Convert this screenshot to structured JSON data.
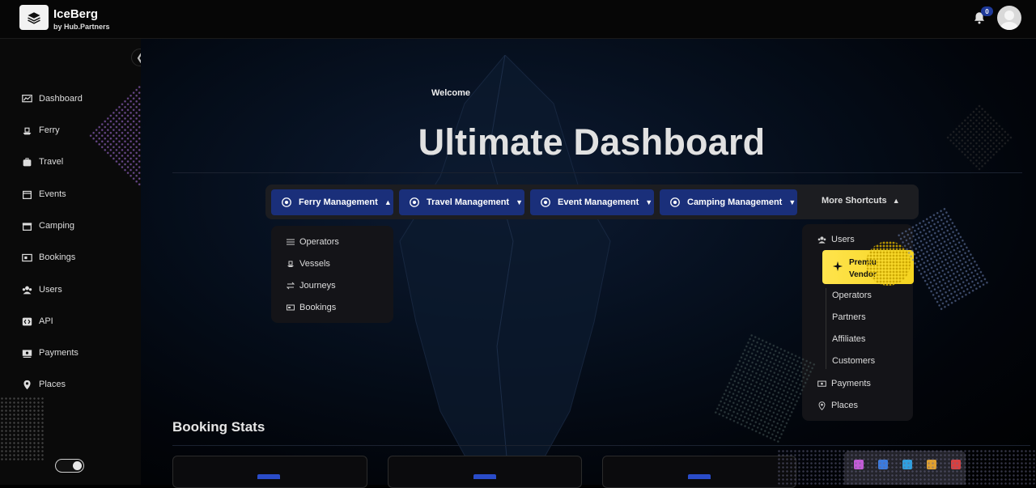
{
  "app": {
    "brand_name": "IceBerg",
    "brand_sub": "by Hub.Partners",
    "notification_count": "0"
  },
  "sidebar": {
    "items": [
      {
        "label": "Dashboard",
        "icon": "dashboard-icon"
      },
      {
        "label": "Ferry",
        "icon": "ferry-icon"
      },
      {
        "label": "Travel",
        "icon": "travel-icon"
      },
      {
        "label": "Events",
        "icon": "events-icon"
      },
      {
        "label": "Camping",
        "icon": "camping-icon"
      },
      {
        "label": "Bookings",
        "icon": "bookings-icon"
      },
      {
        "label": "Users",
        "icon": "users-icon"
      },
      {
        "label": "API",
        "icon": "api-icon"
      },
      {
        "label": "Payments",
        "icon": "payments-icon"
      },
      {
        "label": "Places",
        "icon": "places-icon"
      }
    ]
  },
  "main": {
    "welcome": "Welcome",
    "hero_title": "Ultimate Dashboard",
    "nav": {
      "ferry": "Ferry Management",
      "travel": "Travel Management",
      "event": "Event Management",
      "camping": "Camping Management",
      "more": "More Shortcuts"
    },
    "ferry_dropdown": [
      "Operators",
      "Vessels",
      "Journeys",
      "Bookings"
    ],
    "shortcuts": {
      "users": "Users",
      "premium_line1": "Premiu",
      "premium_line2": "Vendor",
      "sub_items": [
        "Operators",
        "Partners",
        "Affiliates",
        "Customers"
      ],
      "payments": "Payments",
      "places": "Places"
    },
    "stats_title": "Booking Stats"
  },
  "colors": {
    "accent": "#1a2f7a",
    "premium": "#ffe44d",
    "background": "#000000"
  }
}
